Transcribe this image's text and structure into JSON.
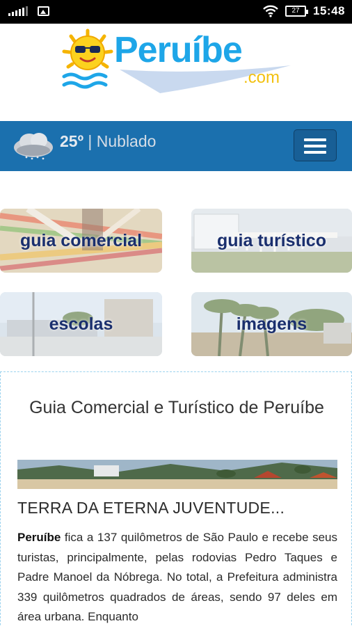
{
  "status_bar": {
    "time": "15:48",
    "battery": "27"
  },
  "brand": {
    "name": "Peruíbe",
    "suffix": ".com"
  },
  "weather": {
    "temperature": "25º",
    "separator": "|",
    "condition": "Nublado"
  },
  "tiles": [
    {
      "label": "guia comercial"
    },
    {
      "label": "guia turístico"
    },
    {
      "label": "escolas"
    },
    {
      "label": "imagens"
    }
  ],
  "article": {
    "title": "Guia Comercial e Turístico de Peruíbe",
    "heading": "TERRA DA ETERNA JUVENTUDE...",
    "lead_bold": "Peruíbe",
    "body": " fica a 137 quilômetros de São Paulo e recebe seus turistas, principalmente, pelas rodovias Pedro Taques e Padre Manoel da Nóbrega. No total, a Prefeitura administra 339 quilômetros quadrados de áreas, sendo 97 deles em área urbana. Enquanto"
  },
  "colors": {
    "brand_blue": "#1ea6e8",
    "brand_yellow": "#f2c110",
    "navbar": "#1b70ae",
    "tile_text": "#1a2f6e"
  }
}
